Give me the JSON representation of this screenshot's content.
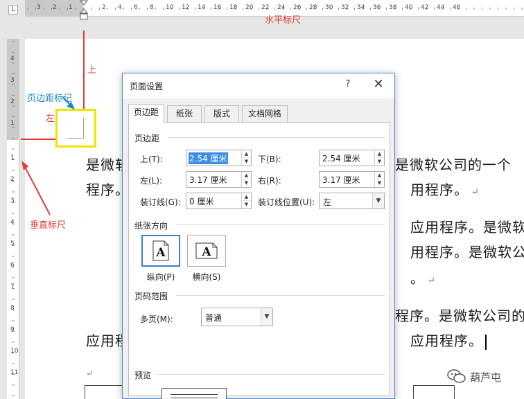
{
  "horizontal_ruler": {
    "corner_label": "L",
    "left_numbers": [
      "3",
      "2",
      "1"
    ],
    "numbers": [
      "2",
      "4",
      "6",
      "8",
      "10",
      "12",
      "14",
      "16",
      "18",
      "20",
      "22",
      "24",
      "26",
      "28",
      "30",
      "32",
      "34",
      "36",
      "38",
      "40",
      "42",
      "44",
      "46"
    ]
  },
  "vertical_ruler": {
    "top_numbers": [
      "4",
      "3",
      "2",
      "1"
    ],
    "numbers": [
      "1",
      "2",
      "3",
      "4",
      "5",
      "6",
      "7",
      "8",
      "9",
      "10",
      "11",
      "12"
    ]
  },
  "annotations": {
    "horizontal_ruler": "水平标尺",
    "top": "上",
    "margin_marker": "页边距标记",
    "left": "左",
    "vertical_ruler": "垂直标尺",
    "colors": {
      "red": "#e53935",
      "blue": "#1e88c8",
      "highlight": "#f2e400"
    }
  },
  "document": {
    "lines": [
      {
        "left": "是微软",
        "right": "是微软公司的一个"
      },
      {
        "left": "程序。",
        "right": "用程序。"
      },
      {
        "left": "",
        "right": "应用程序。是微软"
      },
      {
        "left": "",
        "right": "用程序。是微软公司"
      },
      {
        "left": "",
        "right": "。"
      },
      {
        "left": "本",
        "right": "程序。是微软公司的"
      },
      {
        "left": "应用程",
        "right": "应用程序。"
      }
    ],
    "para_mark": "↵"
  },
  "dialog": {
    "title": "页面设置",
    "help": "?",
    "close": "✕",
    "tabs": [
      "页边距",
      "纸张",
      "版式",
      "文档网格"
    ],
    "active_tab": 0,
    "margins_group": "页边距",
    "fields": {
      "top_label": "上(T):",
      "top_value": "2.54 厘米",
      "bottom_label": "下(B):",
      "bottom_value": "2.54 厘米",
      "left_label": "左(L):",
      "left_value": "3.17 厘米",
      "right_label": "右(R):",
      "right_value": "3.17 厘米",
      "gutter_label": "装订线(G):",
      "gutter_value": "0 厘米",
      "gutter_pos_label": "装订线位置(U):",
      "gutter_pos_value": "左"
    },
    "orientation_group": "纸张方向",
    "portrait_label": "纵向(P)",
    "landscape_label": "横向(S)",
    "orientation_selected": "portrait",
    "orientation_glyph": "A",
    "pages_group": "页码范围",
    "multiple_pages_label": "多页(M):",
    "multiple_pages_value": "普通",
    "preview_group": "预览"
  },
  "watermark": {
    "text": "葫芦屯",
    "icon": "wechat-icon"
  }
}
